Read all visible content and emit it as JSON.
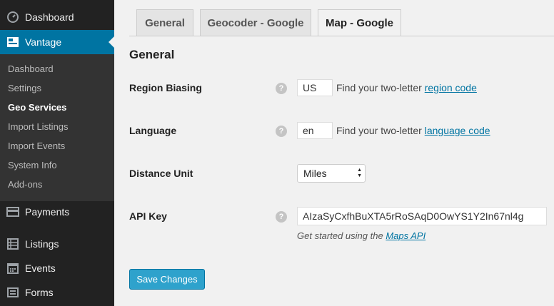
{
  "sidebar": {
    "top_items": [
      {
        "label": "Dashboard",
        "icon": "dashboard-icon"
      },
      {
        "label": "Vantage",
        "icon": "vantage-icon"
      },
      {
        "label": "Payments",
        "icon": "payments-icon"
      },
      {
        "label": "Listings",
        "icon": "listings-icon"
      },
      {
        "label": "Events",
        "icon": "events-icon"
      },
      {
        "label": "Forms",
        "icon": "forms-icon"
      }
    ],
    "submenu": [
      "Dashboard",
      "Settings",
      "Geo Services",
      "Import Listings",
      "Import Events",
      "System Info",
      "Add-ons"
    ],
    "active_submenu": "Geo Services"
  },
  "tabs": [
    "General",
    "Geocoder - Google",
    "Map - Google"
  ],
  "active_tab": "Map - Google",
  "section_title": "General",
  "fields": {
    "region": {
      "label": "Region Biasing",
      "value": "US",
      "desc_prefix": "Find your two-letter",
      "desc_link": "region code"
    },
    "language": {
      "label": "Language",
      "value": "en",
      "desc_prefix": "Find your two-letter",
      "desc_link": "language code"
    },
    "distance": {
      "label": "Distance Unit",
      "value": "Miles"
    },
    "api_key": {
      "label": "API Key",
      "value": "AIzaSyCxfhBuXTA5rRoSAqD0OwYS1Y2In67nl4g",
      "desc_prefix": "Get started using the",
      "desc_link": "Maps API"
    }
  },
  "help_symbol": "?",
  "save_label": "Save Changes",
  "colors": {
    "accent": "#0074a2",
    "button": "#2ea2cc",
    "sidebar": "#222222"
  }
}
